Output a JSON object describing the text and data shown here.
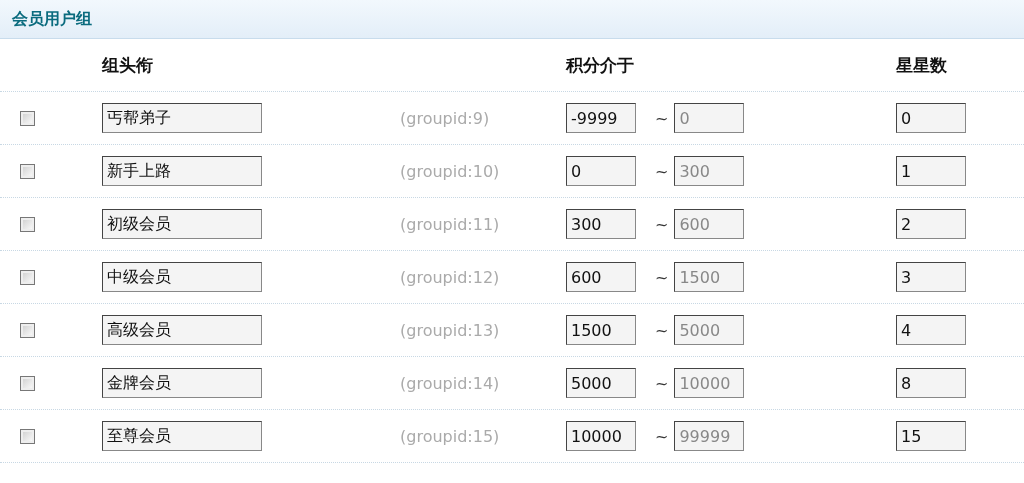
{
  "title": "会员用户组",
  "columns": [
    "组头衔",
    "积分介于",
    "星星数"
  ],
  "rows": [
    {
      "checked": false,
      "name": "丐帮弟子",
      "groupid": "(groupid:9)",
      "min": {
        "value": "-9999",
        "disabled": false
      },
      "max": {
        "value": "0",
        "disabled": true
      },
      "stars_value": "0"
    },
    {
      "checked": false,
      "name": "新手上路",
      "groupid": "(groupid:10)",
      "min": {
        "value": "0",
        "disabled": false
      },
      "max": {
        "value": "300",
        "disabled": true
      },
      "stars_value": "1"
    },
    {
      "checked": false,
      "name": "初级会员",
      "groupid": "(groupid:11)",
      "min": {
        "value": "300",
        "disabled": false
      },
      "max": {
        "value": "600",
        "disabled": true
      },
      "stars_value": "2"
    },
    {
      "checked": false,
      "name": "中级会员",
      "groupid": "(groupid:12)",
      "min": {
        "value": "600",
        "disabled": false
      },
      "max": {
        "value": "1500",
        "disabled": true
      },
      "stars_value": "3"
    },
    {
      "checked": false,
      "name": "高级会员",
      "groupid": "(groupid:13)",
      "min": {
        "value": "1500",
        "disabled": false
      },
      "max": {
        "value": "5000",
        "disabled": true
      },
      "stars_value": "4"
    },
    {
      "checked": false,
      "name": "金牌会员",
      "groupid": "(groupid:14)",
      "min": {
        "value": "5000",
        "disabled": false
      },
      "max": {
        "value": "10000",
        "disabled": true
      },
      "stars_value": "8"
    },
    {
      "checked": false,
      "name": "至尊会员",
      "groupid": "(groupid:15)",
      "min": {
        "value": "10000",
        "disabled": false
      },
      "max": {
        "value": "99999",
        "disabled": true
      },
      "stars_value": "15"
    }
  ],
  "range_separator": "~"
}
